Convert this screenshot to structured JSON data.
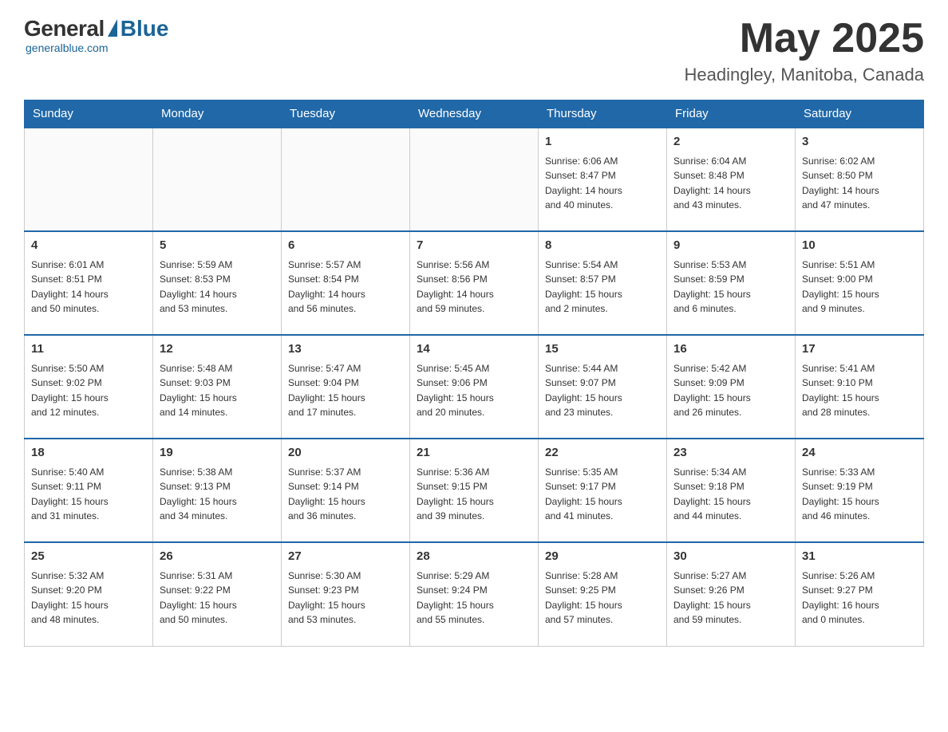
{
  "header": {
    "logo_general": "General",
    "logo_blue": "Blue",
    "logo_subtitle": "generalblue.com",
    "month_year": "May 2025",
    "location": "Headingley, Manitoba, Canada"
  },
  "weekdays": [
    "Sunday",
    "Monday",
    "Tuesday",
    "Wednesday",
    "Thursday",
    "Friday",
    "Saturday"
  ],
  "weeks": [
    [
      {
        "day": "",
        "info": ""
      },
      {
        "day": "",
        "info": ""
      },
      {
        "day": "",
        "info": ""
      },
      {
        "day": "",
        "info": ""
      },
      {
        "day": "1",
        "info": "Sunrise: 6:06 AM\nSunset: 8:47 PM\nDaylight: 14 hours\nand 40 minutes."
      },
      {
        "day": "2",
        "info": "Sunrise: 6:04 AM\nSunset: 8:48 PM\nDaylight: 14 hours\nand 43 minutes."
      },
      {
        "day": "3",
        "info": "Sunrise: 6:02 AM\nSunset: 8:50 PM\nDaylight: 14 hours\nand 47 minutes."
      }
    ],
    [
      {
        "day": "4",
        "info": "Sunrise: 6:01 AM\nSunset: 8:51 PM\nDaylight: 14 hours\nand 50 minutes."
      },
      {
        "day": "5",
        "info": "Sunrise: 5:59 AM\nSunset: 8:53 PM\nDaylight: 14 hours\nand 53 minutes."
      },
      {
        "day": "6",
        "info": "Sunrise: 5:57 AM\nSunset: 8:54 PM\nDaylight: 14 hours\nand 56 minutes."
      },
      {
        "day": "7",
        "info": "Sunrise: 5:56 AM\nSunset: 8:56 PM\nDaylight: 14 hours\nand 59 minutes."
      },
      {
        "day": "8",
        "info": "Sunrise: 5:54 AM\nSunset: 8:57 PM\nDaylight: 15 hours\nand 2 minutes."
      },
      {
        "day": "9",
        "info": "Sunrise: 5:53 AM\nSunset: 8:59 PM\nDaylight: 15 hours\nand 6 minutes."
      },
      {
        "day": "10",
        "info": "Sunrise: 5:51 AM\nSunset: 9:00 PM\nDaylight: 15 hours\nand 9 minutes."
      }
    ],
    [
      {
        "day": "11",
        "info": "Sunrise: 5:50 AM\nSunset: 9:02 PM\nDaylight: 15 hours\nand 12 minutes."
      },
      {
        "day": "12",
        "info": "Sunrise: 5:48 AM\nSunset: 9:03 PM\nDaylight: 15 hours\nand 14 minutes."
      },
      {
        "day": "13",
        "info": "Sunrise: 5:47 AM\nSunset: 9:04 PM\nDaylight: 15 hours\nand 17 minutes."
      },
      {
        "day": "14",
        "info": "Sunrise: 5:45 AM\nSunset: 9:06 PM\nDaylight: 15 hours\nand 20 minutes."
      },
      {
        "day": "15",
        "info": "Sunrise: 5:44 AM\nSunset: 9:07 PM\nDaylight: 15 hours\nand 23 minutes."
      },
      {
        "day": "16",
        "info": "Sunrise: 5:42 AM\nSunset: 9:09 PM\nDaylight: 15 hours\nand 26 minutes."
      },
      {
        "day": "17",
        "info": "Sunrise: 5:41 AM\nSunset: 9:10 PM\nDaylight: 15 hours\nand 28 minutes."
      }
    ],
    [
      {
        "day": "18",
        "info": "Sunrise: 5:40 AM\nSunset: 9:11 PM\nDaylight: 15 hours\nand 31 minutes."
      },
      {
        "day": "19",
        "info": "Sunrise: 5:38 AM\nSunset: 9:13 PM\nDaylight: 15 hours\nand 34 minutes."
      },
      {
        "day": "20",
        "info": "Sunrise: 5:37 AM\nSunset: 9:14 PM\nDaylight: 15 hours\nand 36 minutes."
      },
      {
        "day": "21",
        "info": "Sunrise: 5:36 AM\nSunset: 9:15 PM\nDaylight: 15 hours\nand 39 minutes."
      },
      {
        "day": "22",
        "info": "Sunrise: 5:35 AM\nSunset: 9:17 PM\nDaylight: 15 hours\nand 41 minutes."
      },
      {
        "day": "23",
        "info": "Sunrise: 5:34 AM\nSunset: 9:18 PM\nDaylight: 15 hours\nand 44 minutes."
      },
      {
        "day": "24",
        "info": "Sunrise: 5:33 AM\nSunset: 9:19 PM\nDaylight: 15 hours\nand 46 minutes."
      }
    ],
    [
      {
        "day": "25",
        "info": "Sunrise: 5:32 AM\nSunset: 9:20 PM\nDaylight: 15 hours\nand 48 minutes."
      },
      {
        "day": "26",
        "info": "Sunrise: 5:31 AM\nSunset: 9:22 PM\nDaylight: 15 hours\nand 50 minutes."
      },
      {
        "day": "27",
        "info": "Sunrise: 5:30 AM\nSunset: 9:23 PM\nDaylight: 15 hours\nand 53 minutes."
      },
      {
        "day": "28",
        "info": "Sunrise: 5:29 AM\nSunset: 9:24 PM\nDaylight: 15 hours\nand 55 minutes."
      },
      {
        "day": "29",
        "info": "Sunrise: 5:28 AM\nSunset: 9:25 PM\nDaylight: 15 hours\nand 57 minutes."
      },
      {
        "day": "30",
        "info": "Sunrise: 5:27 AM\nSunset: 9:26 PM\nDaylight: 15 hours\nand 59 minutes."
      },
      {
        "day": "31",
        "info": "Sunrise: 5:26 AM\nSunset: 9:27 PM\nDaylight: 16 hours\nand 0 minutes."
      }
    ]
  ]
}
